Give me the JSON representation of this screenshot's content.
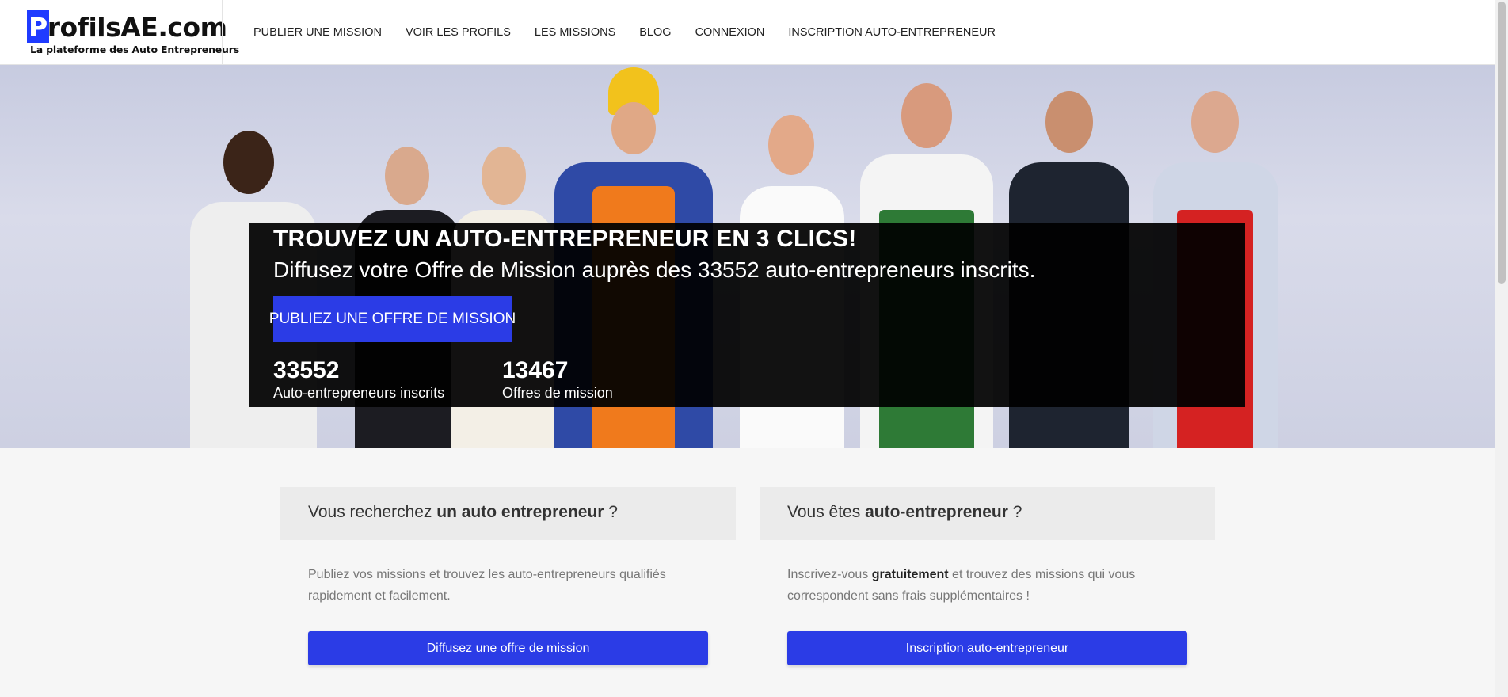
{
  "logo": {
    "first_letter": "P",
    "name_rest": "rofilsAE.com",
    "tagline": "La plateforme des Auto Entrepreneurs"
  },
  "nav": [
    {
      "label": "PUBLIER UNE MISSION"
    },
    {
      "label": "VOIR LES PROFILS"
    },
    {
      "label": "LES MISSIONS"
    },
    {
      "label": "BLOG"
    },
    {
      "label": "CONNEXION"
    },
    {
      "label": "INSCRIPTION AUTO-ENTREPRENEUR"
    }
  ],
  "hero": {
    "title": "TROUVEZ UN AUTO-ENTREPRENEUR EN 3 CLICS!",
    "subtitle": "Diffusez votre Offre de Mission auprès des 33552 auto-entrepreneurs inscrits.",
    "button": "PUBLIEZ UNE OFFRE DE MISSION",
    "stats": [
      {
        "number": "33552",
        "label": "Auto-entrepreneurs inscrits"
      },
      {
        "number": "13467",
        "label": "Offres de mission"
      }
    ]
  },
  "cards": [
    {
      "title_pre": "Vous recherchez ",
      "title_bold": "un auto entrepreneur",
      "title_post": " ?",
      "desc_pre": "Publiez vos missions et trouvez les auto-entrepreneurs qualifiés rapidement et facilement.",
      "desc_bold": "",
      "desc_post": "",
      "button": "Diffusez une offre de mission"
    },
    {
      "title_pre": "Vous êtes ",
      "title_bold": "auto-entrepreneur",
      "title_post": " ?",
      "desc_pre": "Inscrivez-vous ",
      "desc_bold": "gratuitement",
      "desc_post": " et trouvez des missions qui vous correspondent sans frais supplémentaires !",
      "button": "Inscription auto-entrepreneur"
    }
  ],
  "colors": {
    "accent": "#2b3ce6",
    "logo_blue": "#1f3bff"
  }
}
